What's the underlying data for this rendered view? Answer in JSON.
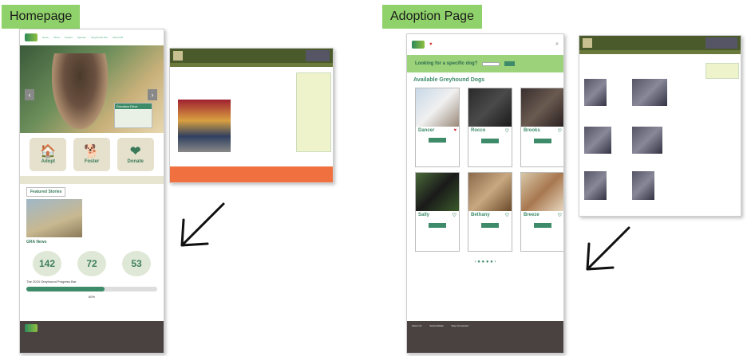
{
  "labels": {
    "homepage": "Homepage",
    "adoption": "Adoption Page"
  },
  "homepage": {
    "nav": [
      "Home",
      "About",
      "Fosters",
      "Sponsor",
      "Greyhound Info",
      "About GR"
    ],
    "donation_title": "Donation Drive",
    "tiles": [
      {
        "label": "Adopt",
        "icon": "house-paw-icon"
      },
      {
        "label": "Foster",
        "icon": "dog-house-icon"
      },
      {
        "label": "Donate",
        "icon": "heart-hand-icon"
      }
    ],
    "featured_title": "Featured Stories",
    "gra_title": "GRA News",
    "stats": [
      "142",
      "72",
      "53"
    ],
    "progress_label": "The 2015 Greyhound Progress Bar",
    "progress_percent": 60,
    "progress_text": "60%"
  },
  "adoption": {
    "search_title": "Looking for a specific dog?",
    "list_title": "Available Greyhound Dogs",
    "dogs": [
      {
        "name": "Dancer",
        "sex": "♂"
      },
      {
        "name": "Rocco",
        "sex": "♂"
      },
      {
        "name": "Brooks",
        "sex": "♂"
      },
      {
        "name": "Sally",
        "sex": "♀"
      },
      {
        "name": "Bethany",
        "sex": "♀"
      },
      {
        "name": "Breeze",
        "sex": "♀"
      }
    ],
    "footer_sections": [
      "About Us",
      "Social Media",
      "Stay Connected"
    ]
  },
  "colors": {
    "label_bg": "#8fd16a",
    "accent": "#3e8b6a",
    "footer": "#4a4240"
  }
}
